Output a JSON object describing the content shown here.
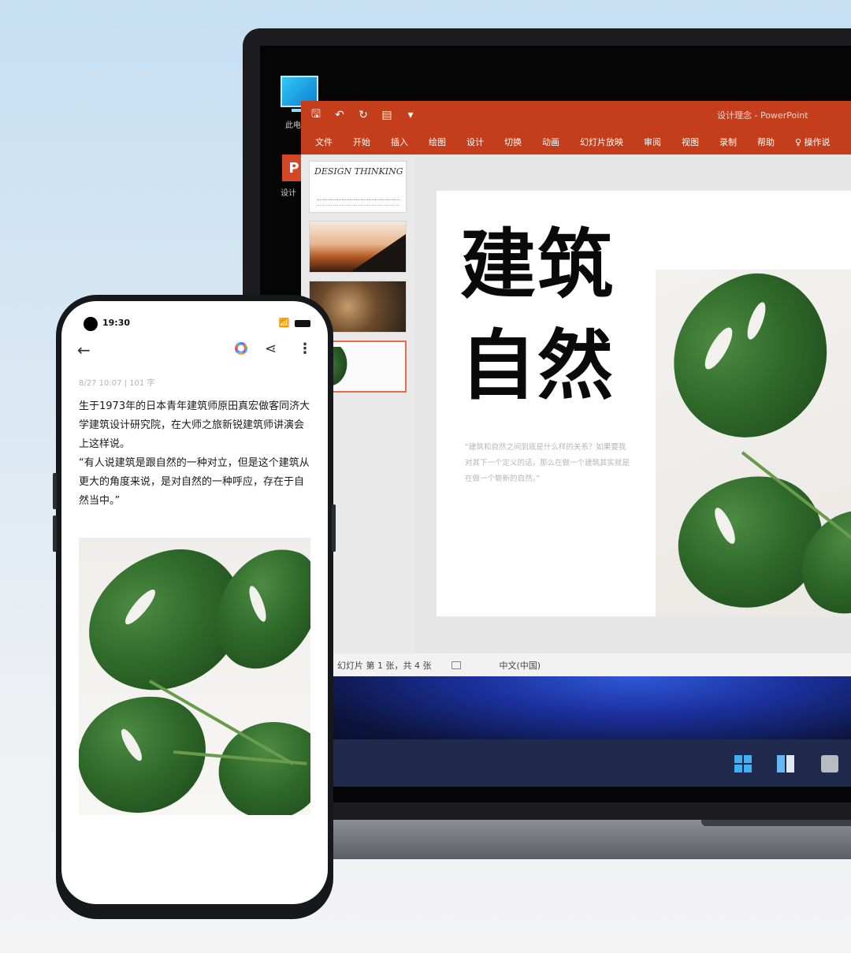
{
  "desktop": {
    "icons": [
      {
        "label": "此电",
        "icon": "computer-icon"
      },
      {
        "label": "设计",
        "icon": "powerpoint-file-icon"
      }
    ]
  },
  "powerpoint": {
    "app_title": "设计理念 - PowerPoint",
    "quick_access": [
      {
        "icon": "save-icon",
        "glyph": "🖫"
      },
      {
        "icon": "undo-icon",
        "glyph": "↶"
      },
      {
        "icon": "redo-icon",
        "glyph": "↻"
      },
      {
        "icon": "present-icon",
        "glyph": "▤"
      },
      {
        "icon": "customize-icon",
        "glyph": "▾"
      }
    ],
    "ribbon_tabs": [
      "文件",
      "开始",
      "插入",
      "绘图",
      "设计",
      "切换",
      "动画",
      "幻灯片放映",
      "审阅",
      "视图",
      "录制",
      "帮助"
    ],
    "ribbon_search": "操作说",
    "thumbnails": [
      {
        "text": "DESIGN THINKING"
      },
      {
        "text": ""
      },
      {
        "text": ""
      },
      {
        "text": "",
        "selected": true
      }
    ],
    "slide": {
      "title_line1": "建筑",
      "title_line2": "自然",
      "quote": "“建筑和自然之间到底是什么样的关系？如果要我对其下一个定义的话，那么在做一个建筑其实就是在做一个崭新的自然。”"
    },
    "status": {
      "slide_position": "幻灯片 第 1 张，共 4 张",
      "language": "中文(中国)"
    }
  },
  "taskbar": {
    "items": [
      "start-icon",
      "task-view-icon",
      "widgets-icon"
    ]
  },
  "phone": {
    "time": "19:30",
    "signal": "📶",
    "note": {
      "meta": "8/27 10:07  |  101 字",
      "body_p1": "生于1973年的日本青年建筑师原田真宏做客同济大学建筑设计研究院，在大师之旅新锐建筑师讲演会上这样说。",
      "body_p2": "“有人说建筑是跟自然的一种对立，但是这个建筑从更大的角度来说，是对自然的一种呼应，存在于自然当中。”"
    }
  },
  "colors": {
    "ppt_accent": "#c43e1c",
    "thumb_selected": "#e46c4b",
    "taskbar": "#1f2a4d"
  }
}
